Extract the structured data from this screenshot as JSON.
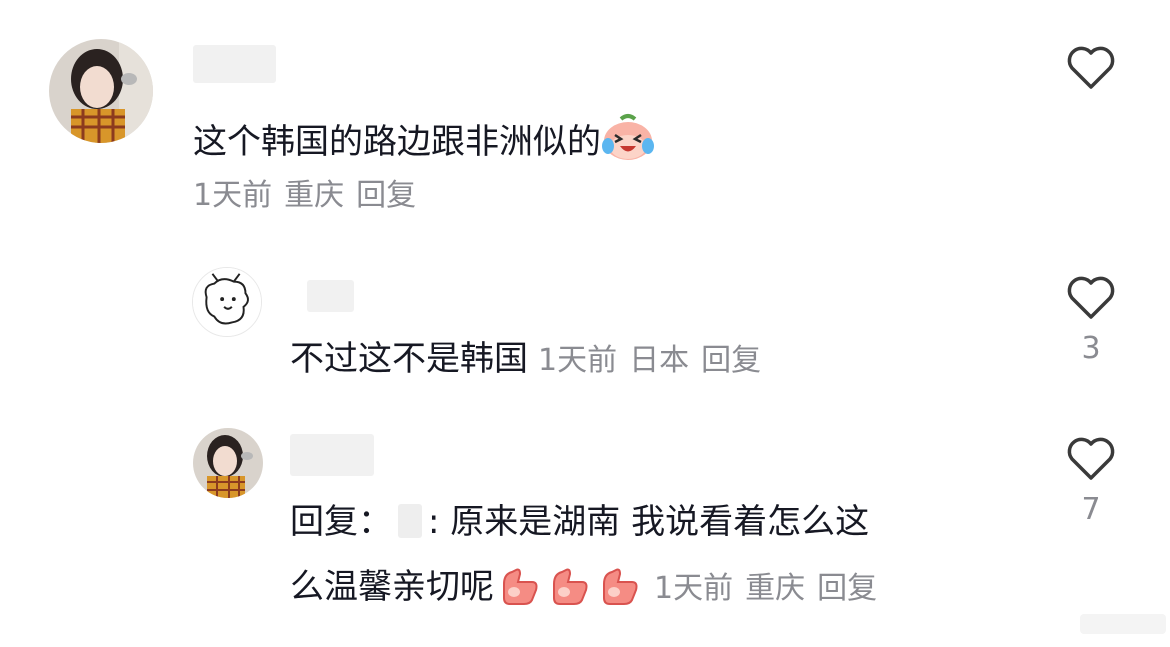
{
  "comments": [
    {
      "text": "这个韩国的路边跟非洲似的",
      "emoji": "laughing-crying-peach-emoji",
      "time": "1天前",
      "location": "重庆",
      "reply_label": "回复",
      "likes": ""
    }
  ],
  "replies": [
    {
      "text": "不过这不是韩国",
      "time": "1天前",
      "location": "日本",
      "reply_label": "回复",
      "likes": "3"
    },
    {
      "prefix": "回复",
      "separator": "：",
      "colon": ":",
      "text_line1": "原来是湖南  我说看着怎么这",
      "text_line2": "么温馨亲切呢",
      "emoji": "peach-thumbs-up-emoji",
      "emoji_count": 3,
      "time": "1天前",
      "location": "重庆",
      "reply_label": "回复",
      "likes": "7"
    }
  ],
  "icons": {
    "like": "heart-outline-icon"
  },
  "colors": {
    "text": "#161823",
    "meta": "#8a8b91",
    "icon": "#3a3a3a"
  }
}
